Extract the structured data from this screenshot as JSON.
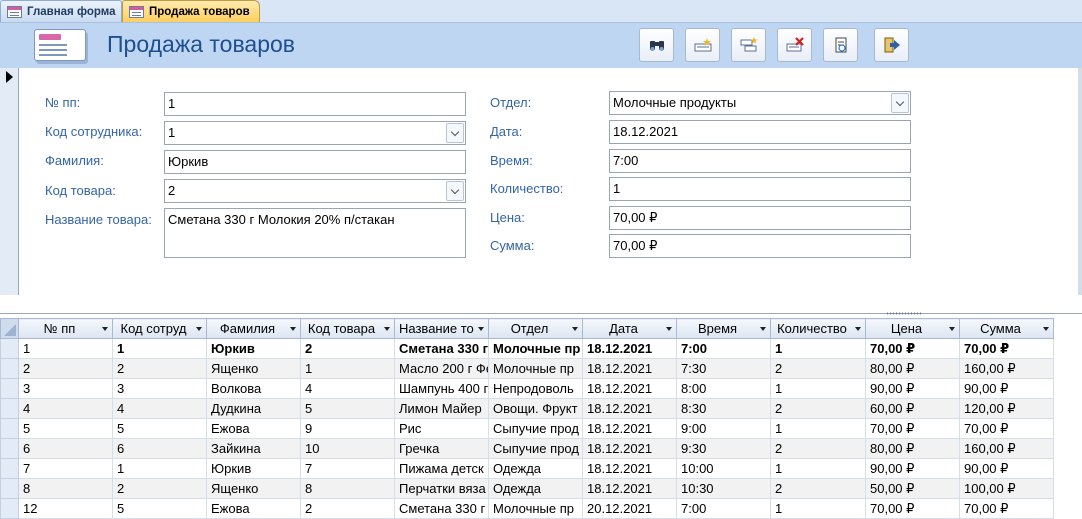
{
  "tabs": [
    {
      "label": "Главная форма",
      "active": false
    },
    {
      "label": "Продажа товаров",
      "active": true
    }
  ],
  "header": {
    "title": "Продажа товаров",
    "buttons": [
      "binoculars-search-icon",
      "new-record-icon",
      "add-record-icon",
      "delete-record-icon",
      "print-icon",
      "close-form-icon"
    ]
  },
  "form": {
    "left": [
      {
        "label": "№ пп:",
        "value": "1",
        "kind": "text"
      },
      {
        "label": "Код сотрудника:",
        "value": "1",
        "kind": "combo"
      },
      {
        "label": "Фамилия:",
        "value": "Юркив",
        "kind": "text"
      },
      {
        "label": "Код товара:",
        "value": "2",
        "kind": "combo"
      },
      {
        "label": "Название товара:",
        "value": "Сметана 330 г Молокия 20% п/стакан",
        "kind": "memo"
      }
    ],
    "right": [
      {
        "label": "Отдел:",
        "value": "Молочные продукты",
        "kind": "combo"
      },
      {
        "label": "Дата:",
        "value": "18.12.2021",
        "kind": "text"
      },
      {
        "label": "Время:",
        "value": "7:00",
        "kind": "text"
      },
      {
        "label": "Количество:",
        "value": "1",
        "kind": "text"
      },
      {
        "label": "Цена:",
        "value": "70,00 ₽",
        "kind": "text"
      },
      {
        "label": "Сумма:",
        "value": "70,00 ₽",
        "kind": "text"
      }
    ]
  },
  "grid": {
    "columns": [
      "№ пп",
      "Код сотруд",
      "Фамилия",
      "Код товара",
      "Название то",
      "Отдел",
      "Дата",
      "Время",
      "Количество",
      "Цена",
      "Сумма"
    ],
    "rows": [
      [
        "1",
        "1",
        "Юркив",
        "2",
        "Сметана 330 г",
        "Молочные пр",
        "18.12.2021",
        "7:00",
        "1",
        "70,00 ₽",
        "70,00 ₽"
      ],
      [
        "2",
        "2",
        "Ященко",
        "1",
        "Масло 200 г Фе",
        "Молочные пр",
        "18.12.2021",
        "7:30",
        "2",
        "80,00 ₽",
        "160,00 ₽"
      ],
      [
        "3",
        "3",
        "Волкова",
        "4",
        "Шампунь 400 г",
        "Непродоволь",
        "18.12.2021",
        "8:00",
        "1",
        "90,00 ₽",
        "90,00 ₽"
      ],
      [
        "4",
        "4",
        "Дудкина",
        "5",
        "Лимон Майер",
        "Овощи. Фрукт",
        "18.12.2021",
        "8:30",
        "2",
        "60,00 ₽",
        "120,00 ₽"
      ],
      [
        "5",
        "5",
        "Ежова",
        "9",
        "Рис",
        "Сыпучие прод",
        "18.12.2021",
        "9:00",
        "1",
        "70,00 ₽",
        "70,00 ₽"
      ],
      [
        "6",
        "6",
        "Зайкина",
        "10",
        "Гречка",
        "Сыпучие прод",
        "18.12.2021",
        "9:30",
        "2",
        "80,00 ₽",
        "160,00 ₽"
      ],
      [
        "7",
        "1",
        "Юркив",
        "7",
        "Пижама детск",
        "Одежда",
        "18.12.2021",
        "10:00",
        "1",
        "90,00 ₽",
        "90,00 ₽"
      ],
      [
        "8",
        "2",
        "Ященко",
        "8",
        "Перчатки вяза",
        "Одежда",
        "18.12.2021",
        "10:30",
        "2",
        "50,00 ₽",
        "100,00 ₽"
      ],
      [
        "12",
        "5",
        "Ежова",
        "2",
        "Сметана 330 г",
        "Молочные пр",
        "20.12.2021",
        "7:00",
        "1",
        "70,00 ₽",
        "70,00 ₽"
      ]
    ]
  },
  "colors": {
    "accent": "#1d4f91",
    "label": "#3465a4",
    "header_bg": "#bfd6f2",
    "active_tab": "#ffcf5c"
  }
}
